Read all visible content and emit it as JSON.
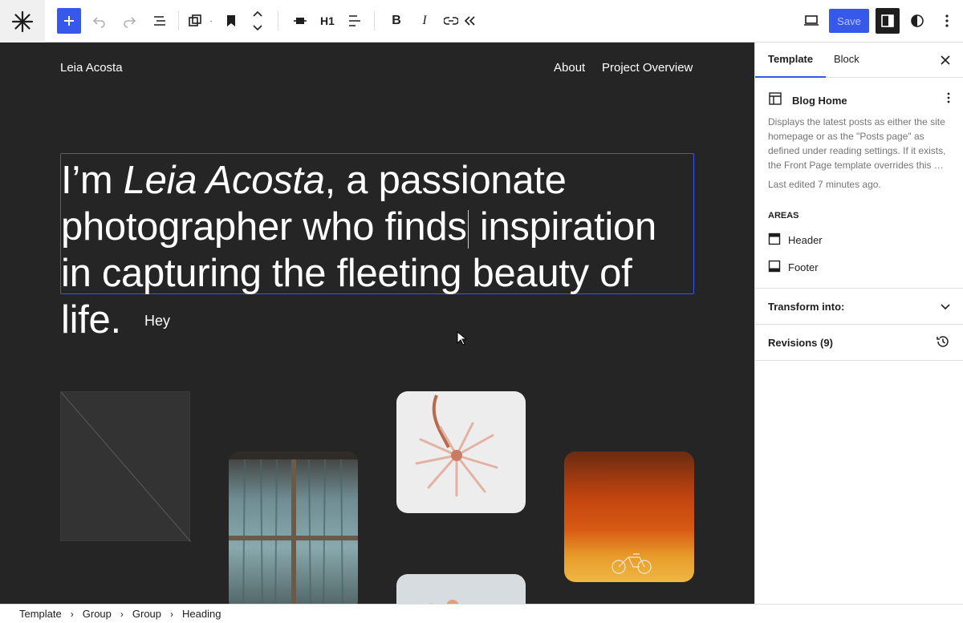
{
  "toolbar": {
    "h1_label": "H1",
    "bold_label": "B",
    "italic_label": "I",
    "save_label": "Save"
  },
  "canvas": {
    "site_title": "Leia Acosta",
    "nav": [
      "About",
      "Project Overview"
    ],
    "heading": {
      "part1": "I’m ",
      "italic": "Leia Acosta",
      "part2": ", a passionate photographer who finds",
      "part3": " inspiration in capturing the fleeting beauty of life."
    },
    "hey_text": "Hey"
  },
  "sidebar": {
    "tabs": [
      "Template",
      "Block"
    ],
    "template": {
      "name": "Blog Home",
      "description": "Displays the latest posts as either the site homepage or as the \"Posts page\" as defined under reading settings. If it exists, the Front Page template overrides this …",
      "last_edited": "Last edited 7 minutes ago."
    },
    "areas_title": "AREAS",
    "areas": [
      "Header",
      "Footer"
    ],
    "transform_label": "Transform into:",
    "revisions_label": "Revisions (9)"
  },
  "breadcrumb": [
    "Template",
    "Group",
    "Group",
    "Heading"
  ],
  "colors": {
    "accent": "#3858e9",
    "canvas_bg": "#252525"
  }
}
